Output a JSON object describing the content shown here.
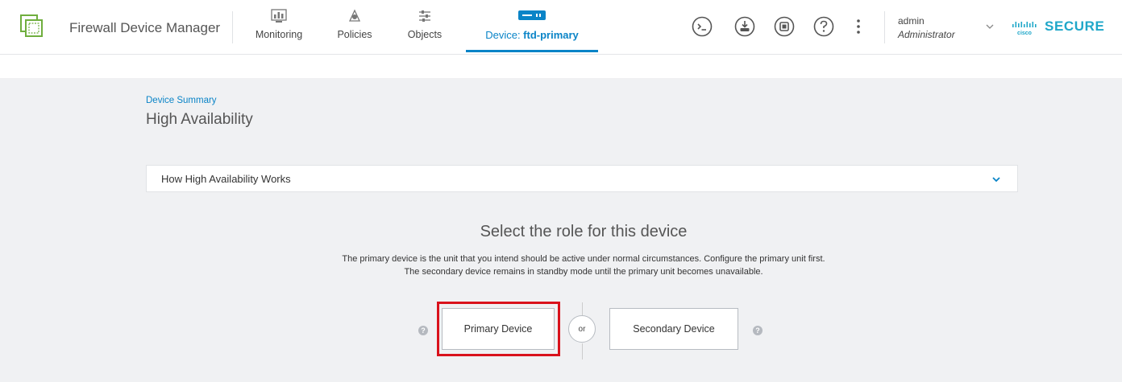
{
  "app": {
    "title": "Firewall Device Manager"
  },
  "nav": {
    "monitoring": "Monitoring",
    "policies": "Policies",
    "objects": "Objects",
    "device_prefix": "Device: ",
    "device_name": "ftd-primary"
  },
  "user": {
    "name": "admin",
    "role": "Administrator"
  },
  "brand": {
    "secure_label": "SECURE"
  },
  "page": {
    "breadcrumb": "Device Summary",
    "title": "High Availability",
    "accordion_label": "How High Availability Works",
    "role_title": "Select the role for this device",
    "role_desc_1": "The primary device is the unit that you intend should be active under normal circumstances. Configure the primary unit first.",
    "role_desc_2": "The secondary device remains in standby mode until the primary unit becomes unavailable.",
    "primary_button": "Primary Device",
    "or_label": "or",
    "secondary_button": "Secondary Device",
    "help_glyph": "?"
  },
  "icons": {
    "monitoring": "monitoring-icon",
    "policies": "policies-icon",
    "objects": "objects-icon",
    "device": "device-icon",
    "cli": "cli-console-icon",
    "deploy": "deploy-icon",
    "api": "api-explorer-icon",
    "help": "help-icon",
    "more": "more-vertical-icon"
  },
  "colors": {
    "accent": "#0a84c7",
    "highlight": "#d9121c",
    "secure": "#1fa7c9",
    "background": "#f0f1f3"
  }
}
